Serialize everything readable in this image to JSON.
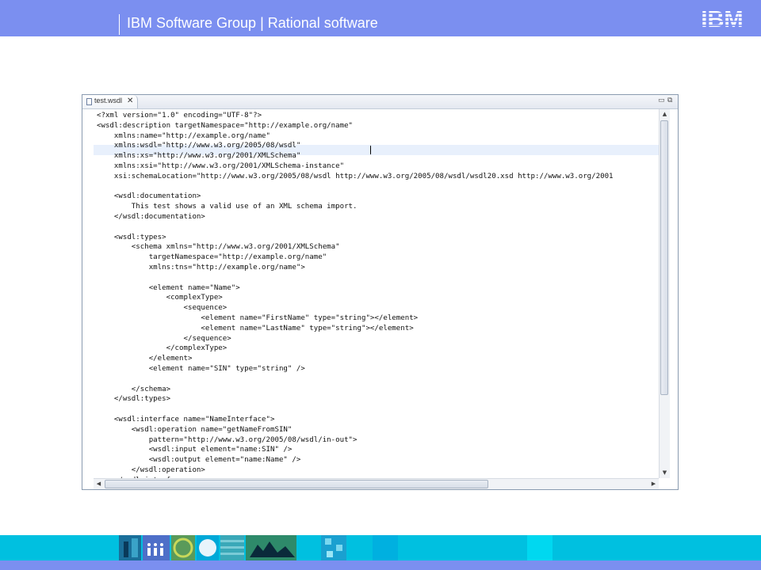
{
  "header": {
    "title": "IBM Software Group | Rational software",
    "logo_text": "IBM"
  },
  "editor": {
    "tab": {
      "label": "test.wsdl",
      "close_glyph": "✕"
    },
    "window_controls": {
      "minimize_glyph": "▭",
      "maximize_glyph": "⧉"
    },
    "scroll_glyphs": {
      "up": "▲",
      "down": "▼",
      "left": "◀",
      "right": "▶"
    },
    "lines": [
      "<?xml version=\"1.0\" encoding=\"UTF-8\"?>",
      "<wsdl:description targetNamespace=\"http://example.org/name\"",
      "    xmlns:name=\"http://example.org/name\"",
      "    xmlns:wsdl=\"http://www.w3.org/2005/08/wsdl\"",
      "    xmlns:xs=\"http://www.w3.org/2001/XMLSchema\"",
      "    xmlns:xsi=\"http://www.w3.org/2001/XMLSchema-instance\"",
      "    xsi:schemaLocation=\"http://www.w3.org/2005/08/wsdl http://www.w3.org/2005/08/wsdl/wsdl20.xsd http://www.w3.org/2001",
      "",
      "    <wsdl:documentation>",
      "        This test shows a valid use of an XML schema import.",
      "    </wsdl:documentation>",
      "",
      "    <wsdl:types>",
      "        <schema xmlns=\"http://www.w3.org/2001/XMLSchema\"",
      "            targetNamespace=\"http://example.org/name\"",
      "            xmlns:tns=\"http://example.org/name\">",
      "",
      "            <element name=\"Name\">",
      "                <complexType>",
      "                    <sequence>",
      "                        <element name=\"FirstName\" type=\"string\"></element>",
      "                        <element name=\"LastName\" type=\"string\"></element>",
      "                    </sequence>",
      "                </complexType>",
      "            </element>",
      "            <element name=\"SIN\" type=\"string\" />",
      "",
      "        </schema>",
      "    </wsdl:types>",
      "",
      "    <wsdl:interface name=\"NameInterface\">",
      "        <wsdl:operation name=\"getNameFromSIN\"",
      "            pattern=\"http://www.w3.org/2005/08/wsdl/in-out\">",
      "            <wsdl:input element=\"name:SIN\" />",
      "            <wsdl:output element=\"name:Name\" />",
      "        </wsdl:operation>",
      "    </wsdl:interface>"
    ]
  },
  "colors": {
    "header_band": "#7b8ff0",
    "bottom_strip": "#00c0e0",
    "current_line": "#e8f0fc"
  }
}
